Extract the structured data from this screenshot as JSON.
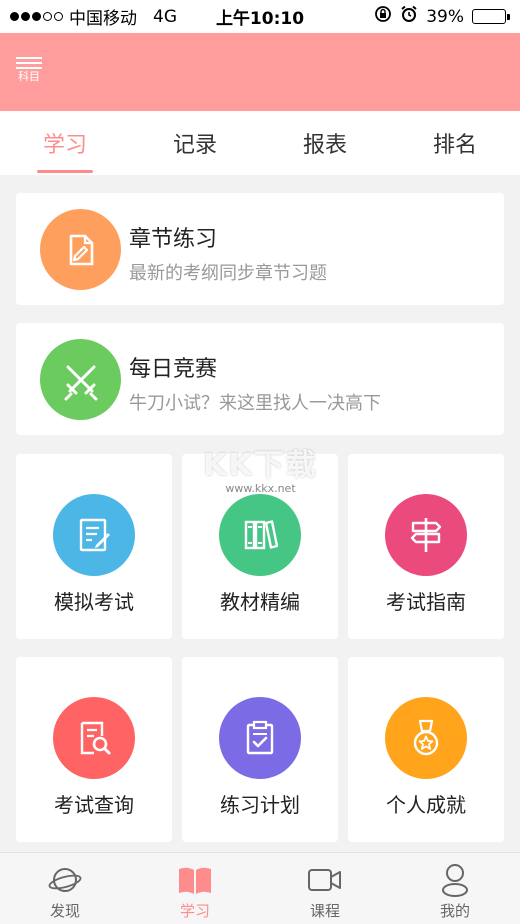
{
  "status_bar": {
    "carrier": "中国移动",
    "network": "4G",
    "time": "上午10:10",
    "battery_percent": "39%",
    "battery_level": 0.39
  },
  "header": {
    "menu_label": "科目"
  },
  "tabs": [
    {
      "label": "学习",
      "active": true
    },
    {
      "label": "记录",
      "active": false
    },
    {
      "label": "报表",
      "active": false
    },
    {
      "label": "排名",
      "active": false
    }
  ],
  "cards": [
    {
      "title": "章节练习",
      "subtitle": "最新的考纲同步章节习题",
      "icon": "document-edit-icon",
      "color": "#ff9f5e"
    },
    {
      "title": "每日竞赛",
      "subtitle": "牛刀小试？来这里找人一决高下",
      "icon": "crossed-swords-icon",
      "color": "#6ccb5f"
    }
  ],
  "grid": [
    {
      "label": "模拟考试",
      "icon": "exam-paper-icon",
      "color": "#4cb6e6"
    },
    {
      "label": "教材精编",
      "icon": "books-icon",
      "color": "#45c685"
    },
    {
      "label": "考试指南",
      "icon": "signpost-icon",
      "color": "#eb4b7c"
    },
    {
      "label": "考试查询",
      "icon": "search-document-icon",
      "color": "#ff6464"
    },
    {
      "label": "练习计划",
      "icon": "clipboard-check-icon",
      "color": "#7b6ce6"
    },
    {
      "label": "个人成就",
      "icon": "medal-icon",
      "color": "#ffa41b"
    }
  ],
  "watermark": {
    "text": "KK下载",
    "url": "www.kkx.net"
  },
  "bottom_nav": [
    {
      "label": "发现",
      "icon": "planet-icon",
      "active": false
    },
    {
      "label": "学习",
      "icon": "open-book-icon",
      "active": true
    },
    {
      "label": "课程",
      "icon": "video-camera-icon",
      "active": false
    },
    {
      "label": "我的",
      "icon": "user-icon",
      "active": false
    }
  ],
  "colors": {
    "accent": "#ff8c8c",
    "header_bg": "#ff9d9d"
  }
}
